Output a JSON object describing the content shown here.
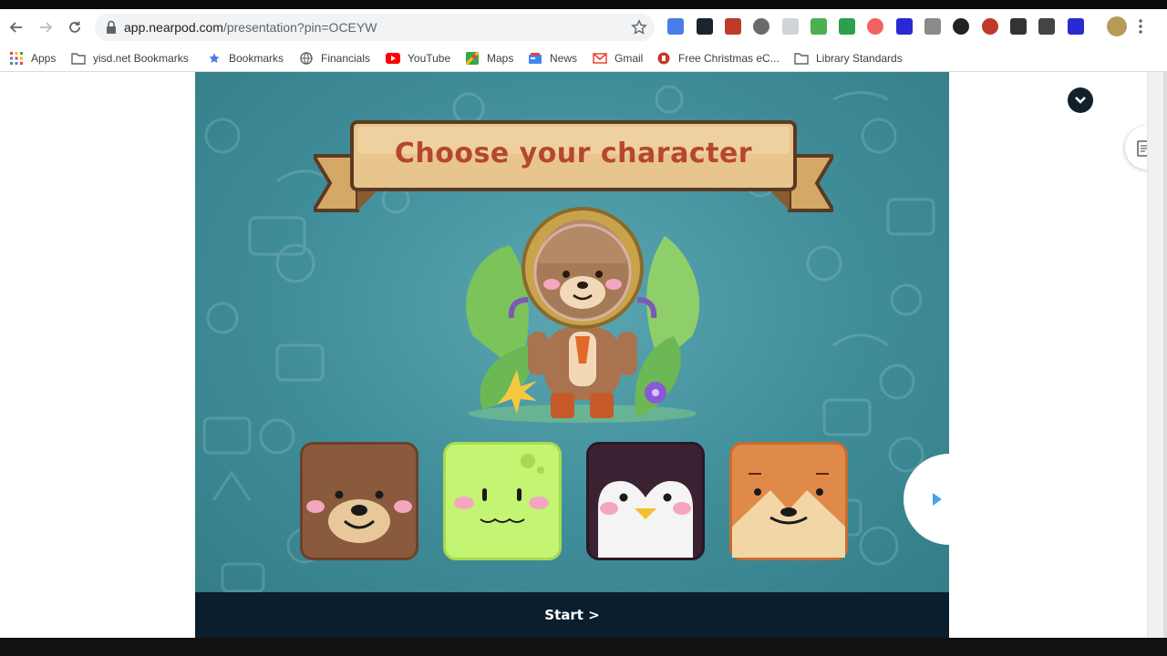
{
  "browser": {
    "url_host": "app.nearpod.com",
    "url_path": "/presentation?pin=OCEYW",
    "extensions": [
      "translate-icon",
      "dark-ext-icon",
      "red-book-icon",
      "read-aloud-icon",
      "pointer-ext-icon",
      "green-ext-icon",
      "cast-icon",
      "arrow-ext-icon",
      "c-blue-icon",
      "c-gray-icon",
      "spinner-ext-icon",
      "fire-ext-icon",
      "crosshair-ext-icon",
      "news-ext-icon",
      "c-blue-2-icon",
      "profile-avatar-icon",
      "more-menu-icon"
    ]
  },
  "bookmarks": [
    {
      "label": "Apps",
      "icon": "apps-grid-icon"
    },
    {
      "label": "yisd.net Bookmarks",
      "icon": "folder-icon"
    },
    {
      "label": "Bookmarks",
      "icon": "star-icon"
    },
    {
      "label": "Financials",
      "icon": "globe-icon"
    },
    {
      "label": "YouTube",
      "icon": "youtube-icon"
    },
    {
      "label": "Maps",
      "icon": "maps-icon"
    },
    {
      "label": "News",
      "icon": "news-icon"
    },
    {
      "label": "Gmail",
      "icon": "gmail-icon"
    },
    {
      "label": "Free Christmas eC...",
      "icon": "christmas-icon"
    },
    {
      "label": "Library Standards",
      "icon": "folder-icon"
    }
  ],
  "activity": {
    "title": "Choose your character",
    "start_label": "Start >",
    "characters": [
      {
        "name": "bear",
        "color": "#8a5a3c",
        "border": "#6b4228"
      },
      {
        "name": "green-blob",
        "color": "#c3f472",
        "border": "#a6db50"
      },
      {
        "name": "penguin",
        "color": "#3a2233",
        "border": "#2a1826"
      },
      {
        "name": "fox",
        "color": "#e08a4a",
        "border": "#c66d32"
      }
    ]
  },
  "colors": {
    "stage": "#3f8d99",
    "banner": "#e9c58e",
    "title": "#b5472c",
    "start_bar": "#0b1e2d"
  }
}
